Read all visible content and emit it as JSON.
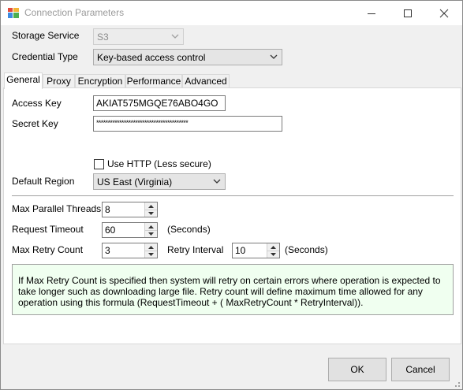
{
  "window": {
    "title": "Connection Parameters",
    "icons": {
      "app": "app-grid-icon",
      "minimize": "minimize-icon",
      "maximize": "maximize-icon",
      "close": "close-icon"
    }
  },
  "storage_service": {
    "label": "Storage Service",
    "value": "S3"
  },
  "credential_type": {
    "label": "Credential Type",
    "value": "Key-based access control"
  },
  "tabs": [
    {
      "label": "General",
      "active": true
    },
    {
      "label": "Proxy",
      "active": false
    },
    {
      "label": "Encryption",
      "active": false
    },
    {
      "label": "Performance",
      "active": false
    },
    {
      "label": "Advanced",
      "active": false
    }
  ],
  "general": {
    "access_key": {
      "label": "Access Key",
      "value": "AKIAT575MGQE76ABO4GO"
    },
    "secret_key": {
      "label": "Secret Key",
      "value": "****************************************"
    },
    "use_http": {
      "label": "Use HTTP (Less secure)",
      "checked": false
    },
    "default_region": {
      "label": "Default Region",
      "value": "US East (Virginia)"
    },
    "max_parallel_threads": {
      "label": "Max Parallel Threads",
      "value": "8"
    },
    "request_timeout": {
      "label": "Request Timeout",
      "value": "60",
      "unit": "(Seconds)"
    },
    "max_retry_count": {
      "label": "Max Retry Count",
      "value": "3"
    },
    "retry_interval": {
      "label": "Retry Interval",
      "value": "10",
      "unit": "(Seconds)"
    },
    "note": "If Max Retry Count is specified then system will retry on certain errors where operation is expected to take longer such as downloading large file. Retry count will define maximum time allowed for any operation using this formula  (RequestTimeout + ( MaxRetryCount * RetryInterval))."
  },
  "buttons": {
    "ok": "OK",
    "cancel": "Cancel"
  },
  "colors": {
    "note_background": "#f0fff0",
    "button_face": "#e1e1e1",
    "title_text": "#9a9a9a"
  }
}
